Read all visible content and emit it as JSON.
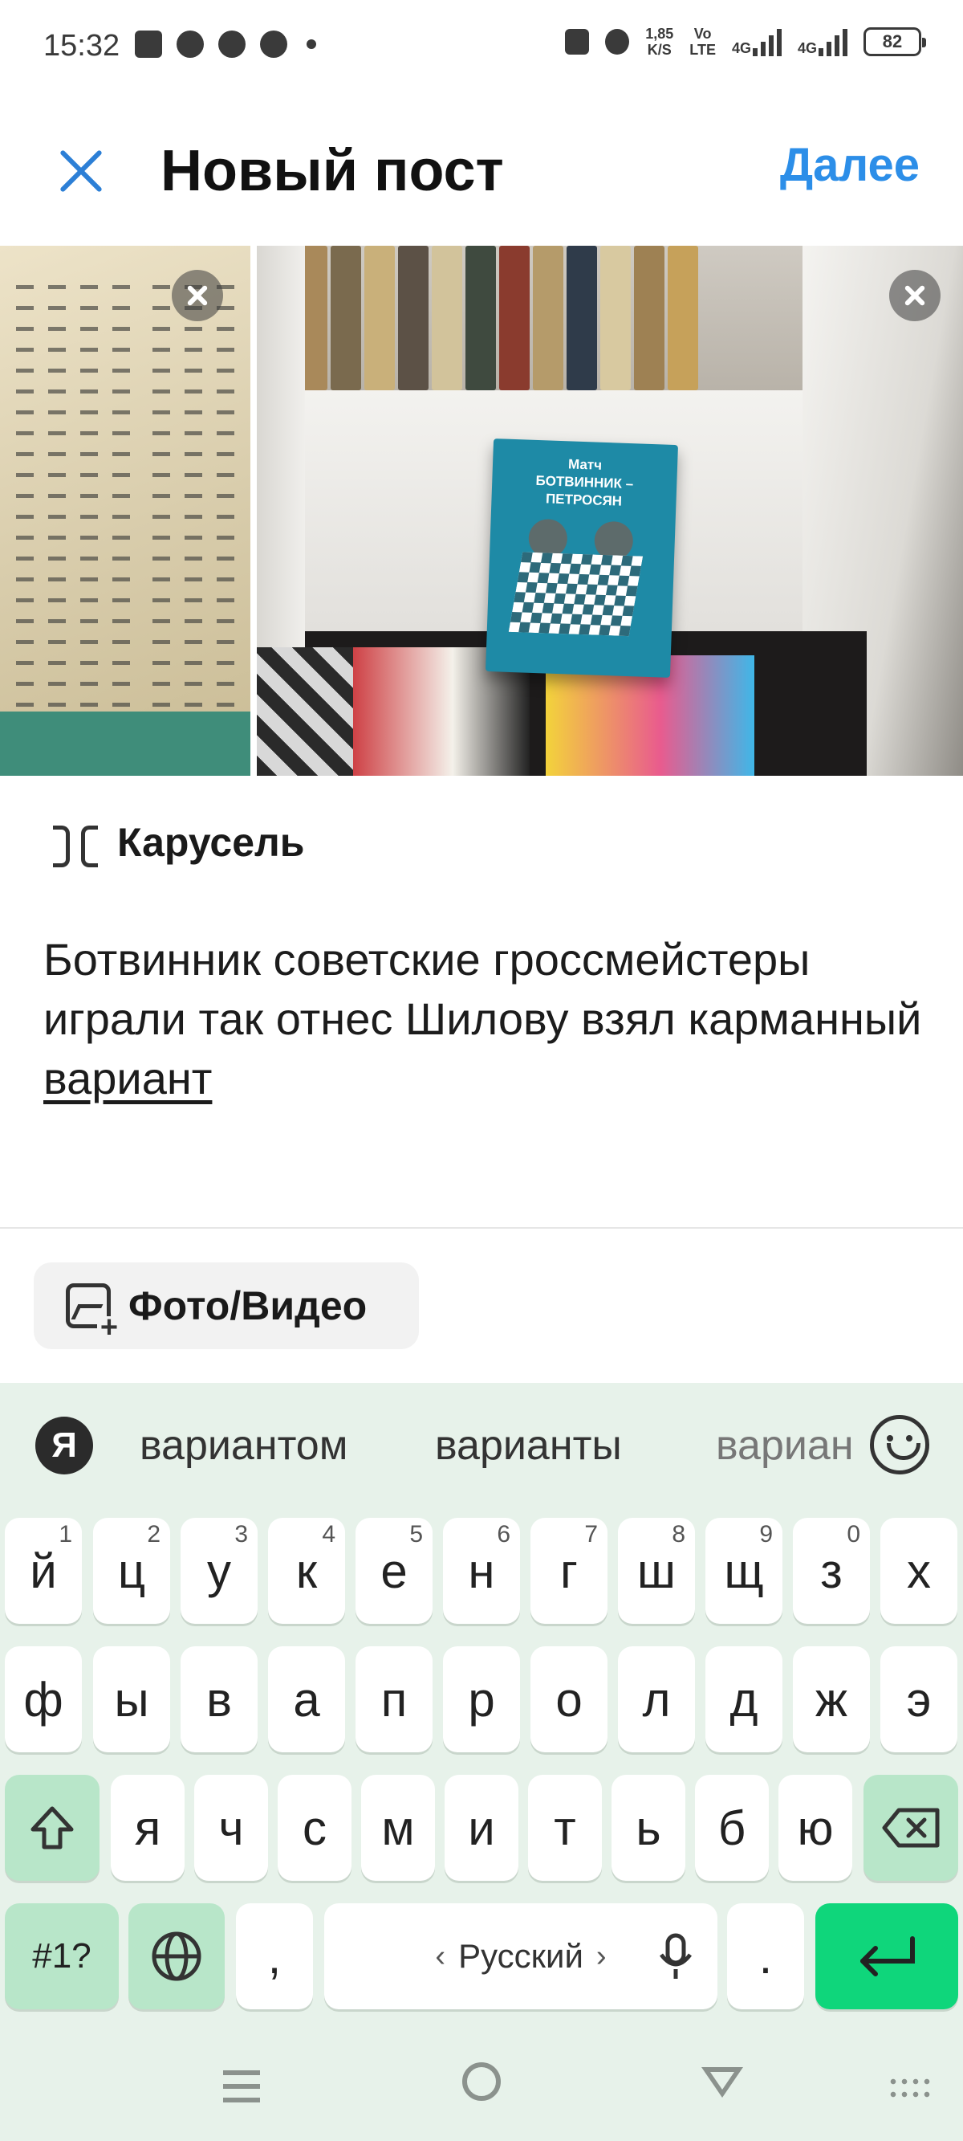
{
  "status": {
    "time": "15:32",
    "net_speed_top": "1,85",
    "net_speed_bottom": "K/S",
    "volte_top": "Vo",
    "volte_bottom": "LTE",
    "sim1": "4G",
    "sim2": "4G",
    "battery": "82"
  },
  "header": {
    "title": "Новый пост",
    "next_label": "Далее",
    "close_icon": "close-icon"
  },
  "carousel": {
    "label": "Карусель",
    "book_title": "Матч\nБОТВИННИК –\nПЕТРОСЯН"
  },
  "caption": {
    "text_main": "Ботвинник советские гроссмейстеры играли так отнес Шилову взял карманный ",
    "text_underlined": "вариант"
  },
  "media_button": {
    "label": "Фото/Видео"
  },
  "keyboard": {
    "logo": "Я",
    "suggestions": [
      "вариантом",
      "варианты",
      "вариан"
    ],
    "row1": [
      {
        "k": "й",
        "h": "1"
      },
      {
        "k": "ц",
        "h": "2"
      },
      {
        "k": "у",
        "h": "3"
      },
      {
        "k": "к",
        "h": "4"
      },
      {
        "k": "е",
        "h": "5"
      },
      {
        "k": "н",
        "h": "6"
      },
      {
        "k": "г",
        "h": "7"
      },
      {
        "k": "ш",
        "h": "8"
      },
      {
        "k": "щ",
        "h": "9"
      },
      {
        "k": "з",
        "h": "0"
      },
      {
        "k": "х",
        "h": ""
      }
    ],
    "row2": [
      "ф",
      "ы",
      "в",
      "а",
      "п",
      "р",
      "о",
      "л",
      "д",
      "ж",
      "э"
    ],
    "row3": [
      "я",
      "ч",
      "с",
      "м",
      "и",
      "т",
      "ь",
      "б",
      "ю"
    ],
    "symbols_key": "#1?",
    "comma_key": ",",
    "space_label": "Русский",
    "period_key": "."
  },
  "colors": {
    "accent_blue": "#2c8ee8",
    "keyboard_bg": "#e7f2ea",
    "enter_key": "#0fd67b"
  }
}
